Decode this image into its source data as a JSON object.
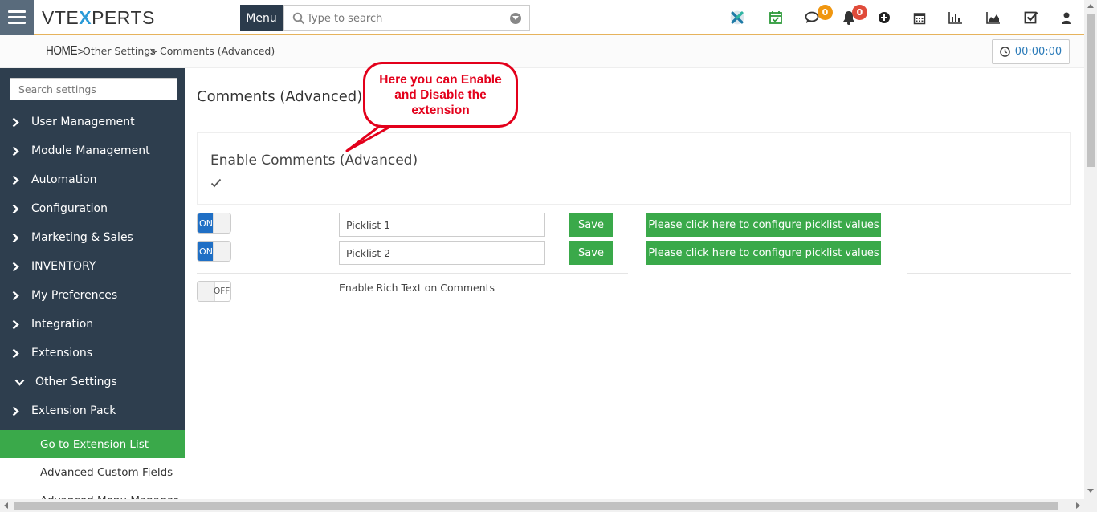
{
  "header": {
    "logo_prefix": "VTE",
    "logo_x": "X",
    "logo_suffix": "PERTS",
    "menu_label": "Menu",
    "search_placeholder": "Type to search",
    "chat_badge": "0",
    "notification_badge": "0"
  },
  "breadcrumb": {
    "home": "HOME",
    "sep1": ">",
    "item1": "Other Settings",
    "sep2": ">",
    "item2": "Comments (Advanced)"
  },
  "timer": {
    "value": "00:00:00"
  },
  "sidebar": {
    "search_placeholder": "Search settings",
    "items": [
      {
        "label": "User Management"
      },
      {
        "label": "Module Management"
      },
      {
        "label": "Automation"
      },
      {
        "label": "Configuration"
      },
      {
        "label": "Marketing & Sales"
      },
      {
        "label": "INVENTORY"
      },
      {
        "label": "My Preferences"
      },
      {
        "label": "Integration"
      },
      {
        "label": "Extensions"
      },
      {
        "label": "Other Settings"
      },
      {
        "label": "Extension Pack"
      }
    ],
    "sub_items": [
      {
        "label": "Go to Extension List"
      },
      {
        "label": "Advanced Custom Fields"
      },
      {
        "label": "Advanced Menu Manager"
      }
    ]
  },
  "main": {
    "page_title": "Comments (Advanced)",
    "enable_title": "Enable Comments (Advanced)",
    "rows": [
      {
        "toggle": "ON",
        "input_value": "Picklist 1",
        "save_label": "Save",
        "config_label": "Please click here to configure picklist values"
      },
      {
        "toggle": "ON",
        "input_value": "Picklist 2",
        "save_label": "Save",
        "config_label": "Please click here to configure picklist values"
      }
    ],
    "rich_text": {
      "toggle": "OFF",
      "label": "Enable Rich Text on Comments"
    }
  },
  "callout": {
    "line1": "Here you can Enable",
    "line2": "and Disable the",
    "line3": "extension"
  },
  "colors": {
    "sidebar_bg": "#2e3e4e",
    "accent_green": "#3aa94a",
    "toggle_on": "#1f6fc5",
    "callout_red": "#e3001b",
    "brand_blue": "#2b9bd8"
  }
}
